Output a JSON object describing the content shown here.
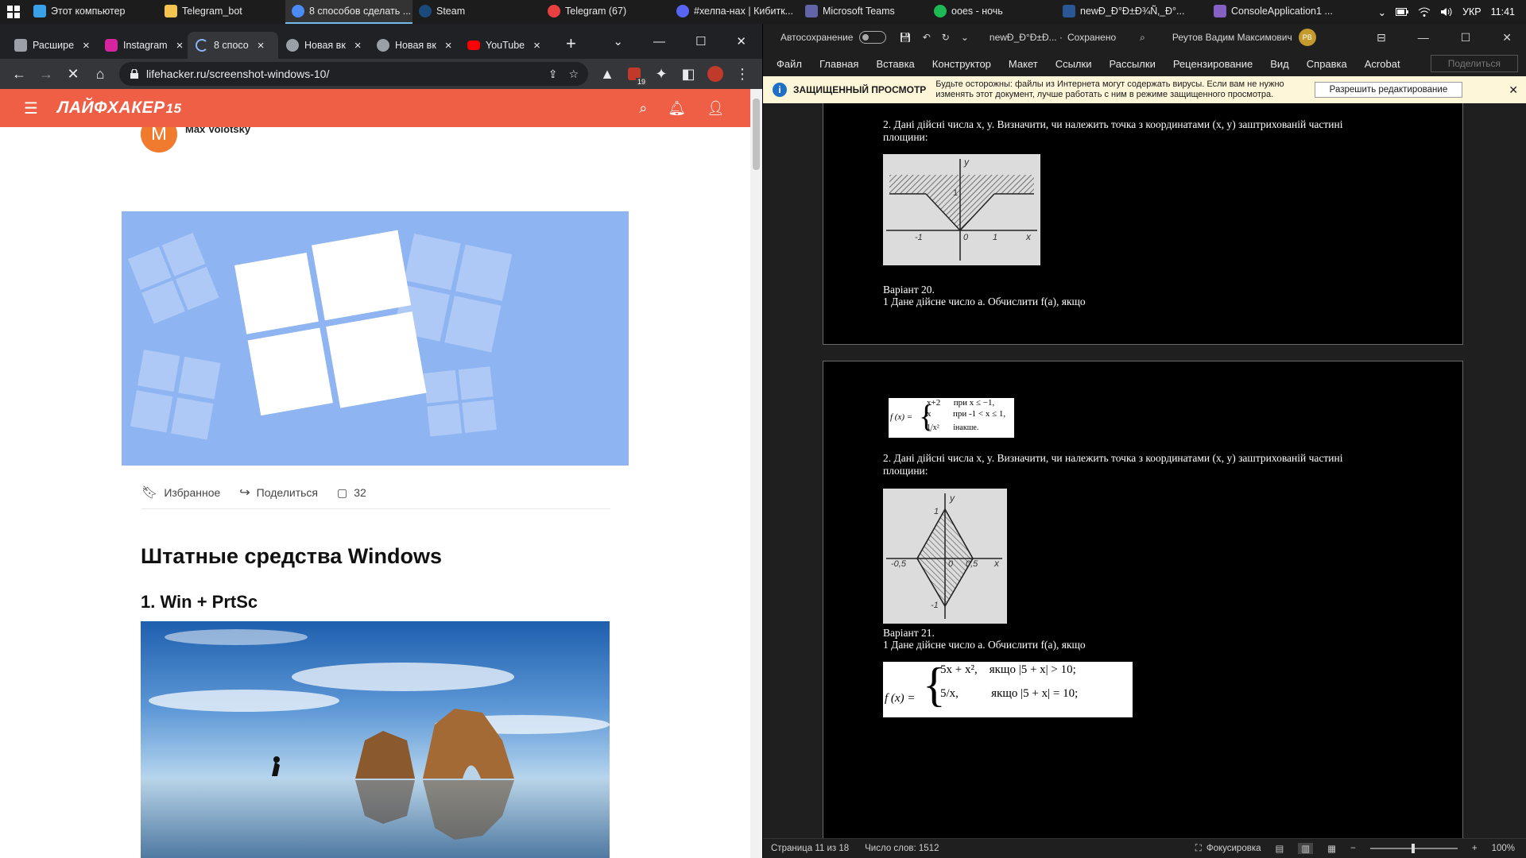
{
  "taskbar": {
    "items": [
      {
        "label": "Этот компьютер",
        "icon": "this-pc-icon",
        "color": "#3aa0e8"
      },
      {
        "label": "Telegram_bot",
        "icon": "folder-icon",
        "color": "#f3c44f"
      },
      {
        "label": "8 способов сделать ...",
        "icon": "chrome-icon",
        "color": "#4c8bf5",
        "active": true
      },
      {
        "label": "Steam",
        "icon": "steam-icon",
        "color": "#1b4a7a"
      },
      {
        "label": "Telegram (67)",
        "icon": "telegram-icon",
        "color": "#e84040"
      },
      {
        "label": "#хелпа-нах | Кибитк...",
        "icon": "discord-icon",
        "color": "#5865f2"
      },
      {
        "label": "Microsoft Teams",
        "icon": "teams-icon",
        "color": "#6264a7"
      },
      {
        "label": "ooes - ночь",
        "icon": "spotify-icon",
        "color": "#1db954"
      },
      {
        "label": "newÐ_Ð°Ð±Ð¾Ñ‚_Ð°...",
        "icon": "word-icon",
        "color": "#2b5797"
      },
      {
        "label": "ConsoleApplication1 ...",
        "icon": "visual-studio-icon",
        "color": "#8661c5"
      }
    ],
    "tray": {
      "lang": "УКР",
      "time": "11:41"
    }
  },
  "browser": {
    "tabs": [
      {
        "label": "Расшире",
        "icon": "puzzle-icon",
        "color": "#9aa0a6"
      },
      {
        "label": "Instagram",
        "icon": "instagram-icon",
        "color": "#d6249f"
      },
      {
        "label": "8 спосо",
        "icon": "loading-icon",
        "color": "#8ab4f8",
        "active": true
      },
      {
        "label": "Новая вк",
        "icon": "chrome-icon",
        "color": "#9aa0a6"
      },
      {
        "label": "Новая вк",
        "icon": "chrome-icon",
        "color": "#9aa0a6"
      },
      {
        "label": "YouTube",
        "icon": "youtube-icon",
        "color": "#ff0000"
      }
    ],
    "url": "lifehacker.ru/screenshot-windows-10/",
    "extension_badge": "19"
  },
  "site": {
    "logo": "ЛАЙФХАКЕР",
    "logo_badge": "15",
    "author_initial": "M",
    "author": "Max Volotsky",
    "actions": {
      "favorites": "Избранное",
      "share": "Поделиться",
      "comments": "32"
    },
    "h2": "Штатные средства Windows",
    "h3": "1. Win + PrtSc"
  },
  "word": {
    "autosave": "Автосохранение",
    "filename": "newÐ_Ð°Ð±Ð... ·",
    "saved": "Сохранено",
    "user": "Реутов Вадим Максимович",
    "user_initials": "РВ",
    "menu": [
      "Файл",
      "Главная",
      "Вставка",
      "Конструктор",
      "Макет",
      "Ссылки",
      "Рассылки",
      "Рецензирование",
      "Вид",
      "Справка",
      "Acrobat"
    ],
    "share": "Поделиться",
    "protected_title": "ЗАЩИЩЕННЫЙ ПРОСМОТР",
    "protected_text_1": "Будьте осторожны: файлы из Интернета могут содержать вирусы. Если вам не нужно",
    "protected_text_2": "изменять этот документ, лучше работать с ним в режиме защищенного просмотра.",
    "enable_editing": "Разрешить редактирование",
    "doc": {
      "task2": "2. Дані дійсні числа x, y. Визначити, чи належить точка з координатами (x, y) заштрихованій частині",
      "task2b": "площини:",
      "variant20": "Варіант 20.",
      "task1_20": "1 Дане дійсне число a. Обчислити f(a), якщо",
      "variant21": "Варіант 21.",
      "task1_21": "1 Дане дійсне число a. Обчислити f(a), якщо",
      "f20": {
        "lhs": "f (x) =",
        "rows": [
          "x+2      при x ≤ −1,",
          "x          при -1 < x ≤ 1,",
          "1/x²       інакше."
        ]
      },
      "f21": {
        "lhs": "f (x) =",
        "rows": [
          "5x + x²,    якщо |5 + x| > 10;",
          "5/x,           якщо |5 + x| = 10;"
        ]
      },
      "fig1_labels": {
        "y": "y",
        "one": "1",
        "m1": "-1",
        "zero": "0",
        "p1": "1",
        "x": "x"
      },
      "fig2_labels": {
        "y": "y",
        "one": "1",
        "m05": "-0,5",
        "zero": "0",
        "p05": "0,5",
        "x": "x",
        "m1": "-1"
      }
    },
    "status": {
      "page": "Страница 11 из 18",
      "words": "Число слов: 1512",
      "focus": "Фокусировка",
      "zoom": "100%"
    }
  }
}
